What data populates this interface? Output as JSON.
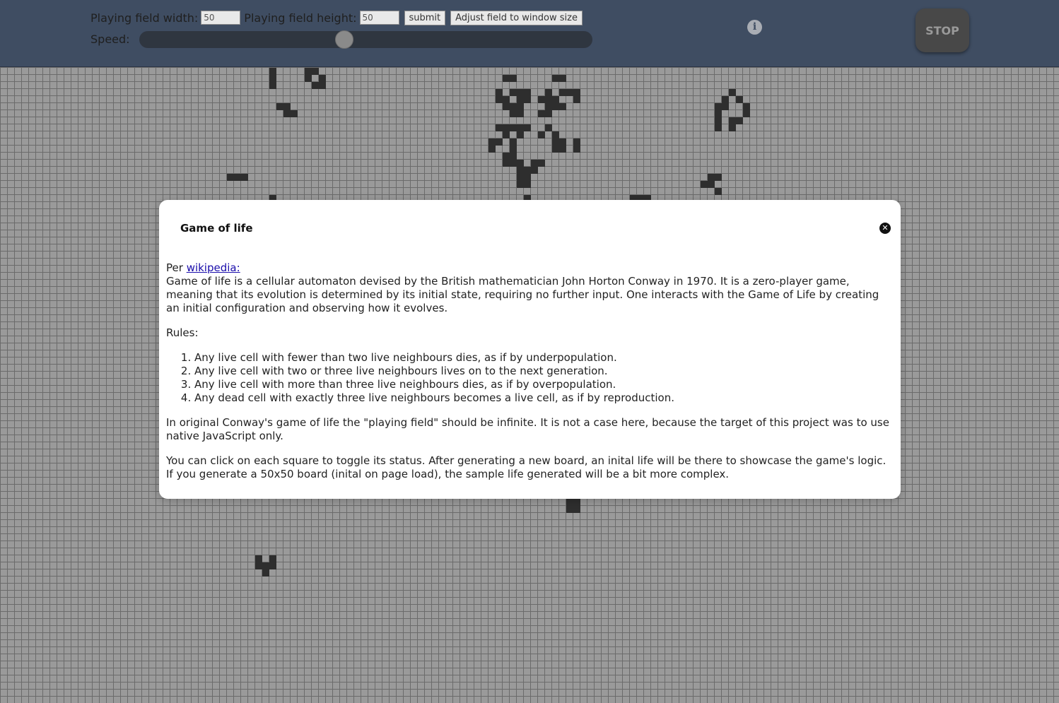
{
  "controls": {
    "width_label": "Playing field width:",
    "width_value": "50",
    "height_label": "Playing field height:",
    "height_value": "50",
    "submit_label": "submit",
    "adjust_label": "Adjust field to window size",
    "speed_label": "Speed:",
    "speed_fraction": 0.45
  },
  "info_icon": "info-icon",
  "stop_label": "STOP",
  "colors": {
    "header_bg": "#3f4d62",
    "board_bg": "#9a9a9a",
    "grid_line": "#6b6b6b",
    "live_cell": "#2e2e2e"
  },
  "modal": {
    "title": "Game of life",
    "close_icon": "close-icon",
    "intro_prefix": "Per ",
    "link_text": "wikipedia:",
    "intro_text": "Game of life is a cellular automaton devised by the British mathematician John Horton Conway in 1970. It is a zero-player game, meaning that its evolution is determined by its initial state, requiring no further input. One interacts with the Game of Life by creating an initial configuration and observing how it evolves.",
    "rules_heading": "Rules:",
    "rules": [
      "Any live cell with fewer than two live neighbours dies, as if by underpopulation.",
      "Any live cell with two or three live neighbours lives on to the next generation.",
      "Any live cell with more than three live neighbours dies, as if by overpopulation.",
      "Any dead cell with exactly three live neighbours becomes a live cell, as if by reproduction."
    ],
    "note": "In original Conway's game of life the \"playing field\" should be infinite. It is not a case here, because the target of this project was to use native JavaScript only.",
    "tip": "You can click on each square to toggle its status. After generating a new board, an inital life will be there to showcase the game's logic. If you generate a 50x50 board (inital on page load), the sample life generated will be a bit more complex."
  }
}
